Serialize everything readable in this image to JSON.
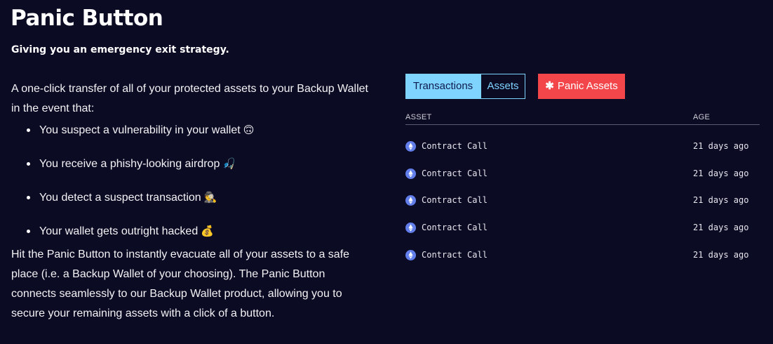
{
  "header": {
    "title": "Panic Button",
    "subtitle": "Giving you an emergency exit strategy."
  },
  "description": {
    "intro": "A one-click transfer of all of your protected assets to your Backup Wallet in the event that:",
    "bullets": [
      {
        "text": "You suspect a vulnerability in your wallet",
        "emoji": "🙃"
      },
      {
        "text": "You receive a phishy-looking airdrop",
        "emoji": "🎣"
      },
      {
        "text": "You detect a suspect transaction",
        "emoji": "🕵"
      },
      {
        "text": "Your wallet gets outright hacked",
        "emoji": "💰"
      }
    ],
    "outro": "Hit the Panic Button to instantly evacuate all of your assets to a safe place (i.e. a Backup Wallet of your choosing). The Panic Button connects seamlessly to our Backup Wallet product, allowing you to secure your remaining assets with a click of a button."
  },
  "panel": {
    "tabs": [
      {
        "label": "Transactions",
        "active": true
      },
      {
        "label": "Assets",
        "active": false
      }
    ],
    "panic_button": {
      "icon": "asterisk-icon",
      "label": "Panic Assets"
    },
    "columns": {
      "asset": "ASSET",
      "age": "AGE"
    },
    "rows": [
      {
        "icon": "ethereum-icon",
        "asset": "Contract Call",
        "age": "21 days ago"
      },
      {
        "icon": "ethereum-icon",
        "asset": "Contract Call",
        "age": "21 days ago"
      },
      {
        "icon": "ethereum-icon",
        "asset": "Contract Call",
        "age": "21 days ago"
      },
      {
        "icon": "ethereum-icon",
        "asset": "Contract Call",
        "age": "21 days ago"
      },
      {
        "icon": "ethereum-icon",
        "asset": "Contract Call",
        "age": "21 days ago"
      }
    ]
  },
  "colors": {
    "background": "#0c0b24",
    "tab_accent": "#7fd3ff",
    "panic_red": "#f2464a",
    "eth_blue": "#627eea"
  }
}
